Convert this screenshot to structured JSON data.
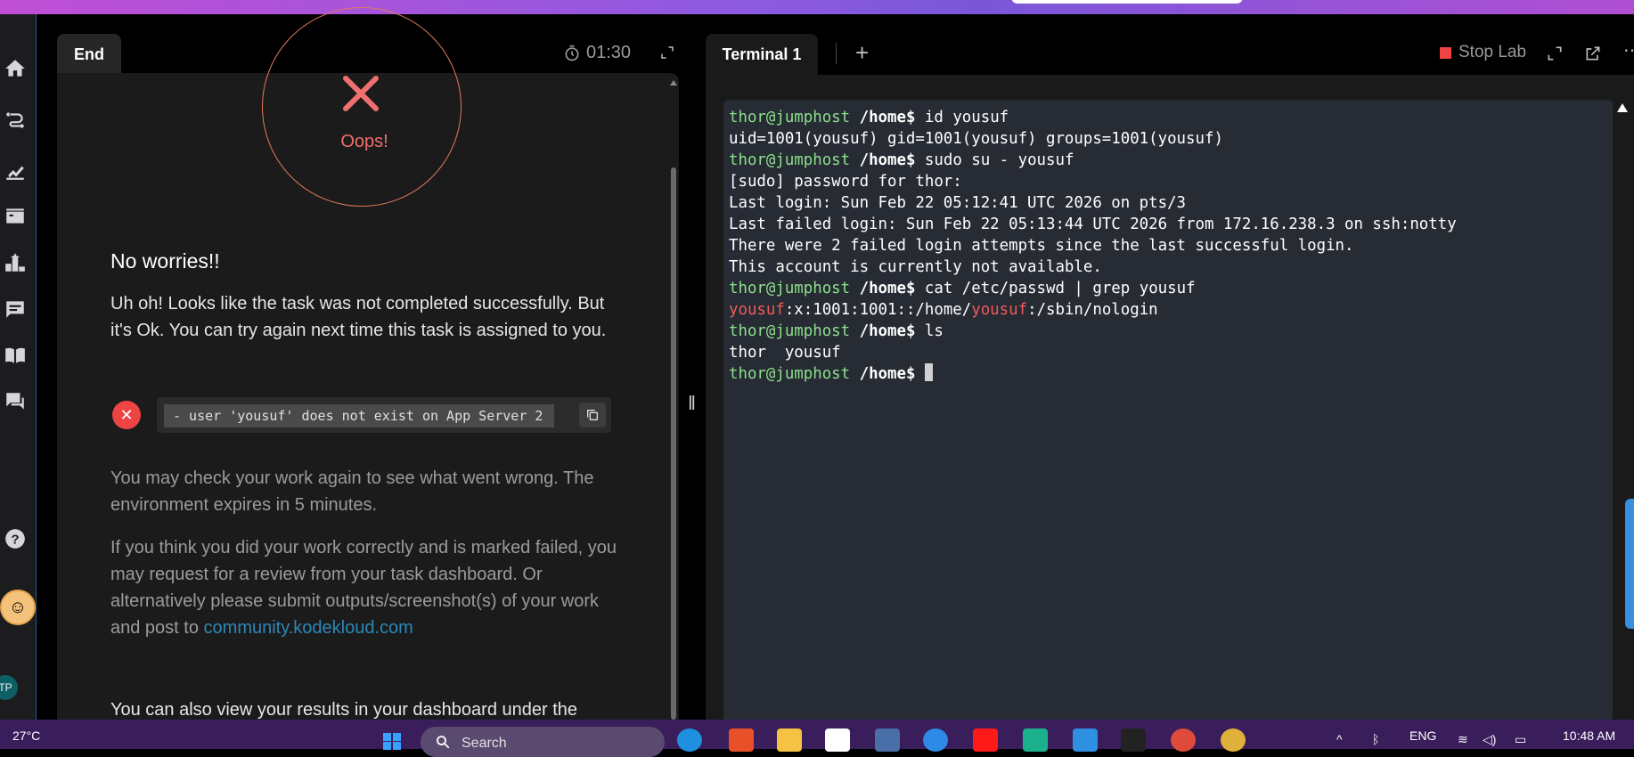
{
  "left_panel": {
    "tab_label": "End",
    "timer": "01:30",
    "oops_label": "Oops!",
    "heading": "No worries!!",
    "message": "Uh oh! Looks like the task was not completed successfully. But it's Ok. You can try again next time this task is assigned to you.",
    "error_text": "- user 'yousuf' does not exist on App Server 2",
    "check_again": "You may check your work again to see what went wrong. The environment expires in 5 minutes.",
    "review_text": "If you think you did your work correctly and is marked failed, you may request for a review from your task dashboard. Or alternatively please submit outputs/screenshot(s) of your work and post to ",
    "review_link": "community.kodekloud.com",
    "bottom_text": "You can also view your results in your dashboard under the"
  },
  "right_panel": {
    "tab_label": "Terminal 1",
    "stop_lab_label": "Stop Lab",
    "prompt_user": "thor@jumphost",
    "prompt_path": "/home$",
    "lines": [
      {
        "type": "cmd",
        "text": " id yousuf"
      },
      {
        "type": "out",
        "text": "uid=1001(yousuf) gid=1001(yousuf) groups=1001(yousuf)"
      },
      {
        "type": "cmd",
        "text": " sudo su - yousuf"
      },
      {
        "type": "out",
        "text": "[sudo] password for thor:"
      },
      {
        "type": "out",
        "text": "Last login: Sun Feb 22 05:12:41 UTC 2026 on pts/3"
      },
      {
        "type": "out",
        "text": "Last failed login: Sun Feb 22 05:13:44 UTC 2026 from 172.16.238.3 on ssh:notty"
      },
      {
        "type": "out",
        "text": "There were 2 failed login attempts since the last successful login."
      },
      {
        "type": "out",
        "text": "This account is currently not available."
      },
      {
        "type": "cmd",
        "text": " cat /etc/passwd | grep yousuf"
      },
      {
        "type": "passwd",
        "p1": "yousuf",
        "p2": ":x:1001:1001::/home/",
        "p3": "yousuf",
        "p4": ":/sbin/nologin"
      },
      {
        "type": "cmd",
        "text": " ls"
      },
      {
        "type": "out",
        "text": "thor  yousuf"
      },
      {
        "type": "prompt",
        "text": " "
      }
    ]
  },
  "taskbar": {
    "temperature": "27°C",
    "search_placeholder": "Search",
    "language": "ENG",
    "time": "10:48 AM"
  },
  "sidebar": {
    "avatar_initials": "TP"
  }
}
